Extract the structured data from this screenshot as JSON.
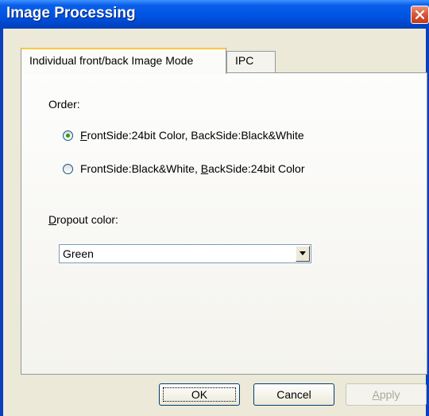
{
  "window": {
    "title": "Image Processing"
  },
  "tabs": [
    {
      "label": "Individual front/back Image Mode",
      "active": true
    },
    {
      "label": "IPC",
      "active": false
    }
  ],
  "order": {
    "label": "Order:",
    "options": [
      {
        "pre": "",
        "mnemonic": "F",
        "post": "rontSide:24bit Color, BackSide:Black&White",
        "checked": true
      },
      {
        "pre": "FrontSide:Black&White, ",
        "mnemonic": "B",
        "post": "ackSide:24bit Color",
        "checked": false
      }
    ]
  },
  "dropout": {
    "label_mnemonic": "D",
    "label_rest": "ropout color:",
    "value": "Green"
  },
  "buttons": {
    "ok": "OK",
    "cancel": "Cancel",
    "apply_mnemonic": "A",
    "apply_rest": "pply"
  },
  "colors": {
    "titlebar": "#0054e3",
    "face": "#ece9d8",
    "close": "#d9593a",
    "radio_dot": "#21a121"
  }
}
